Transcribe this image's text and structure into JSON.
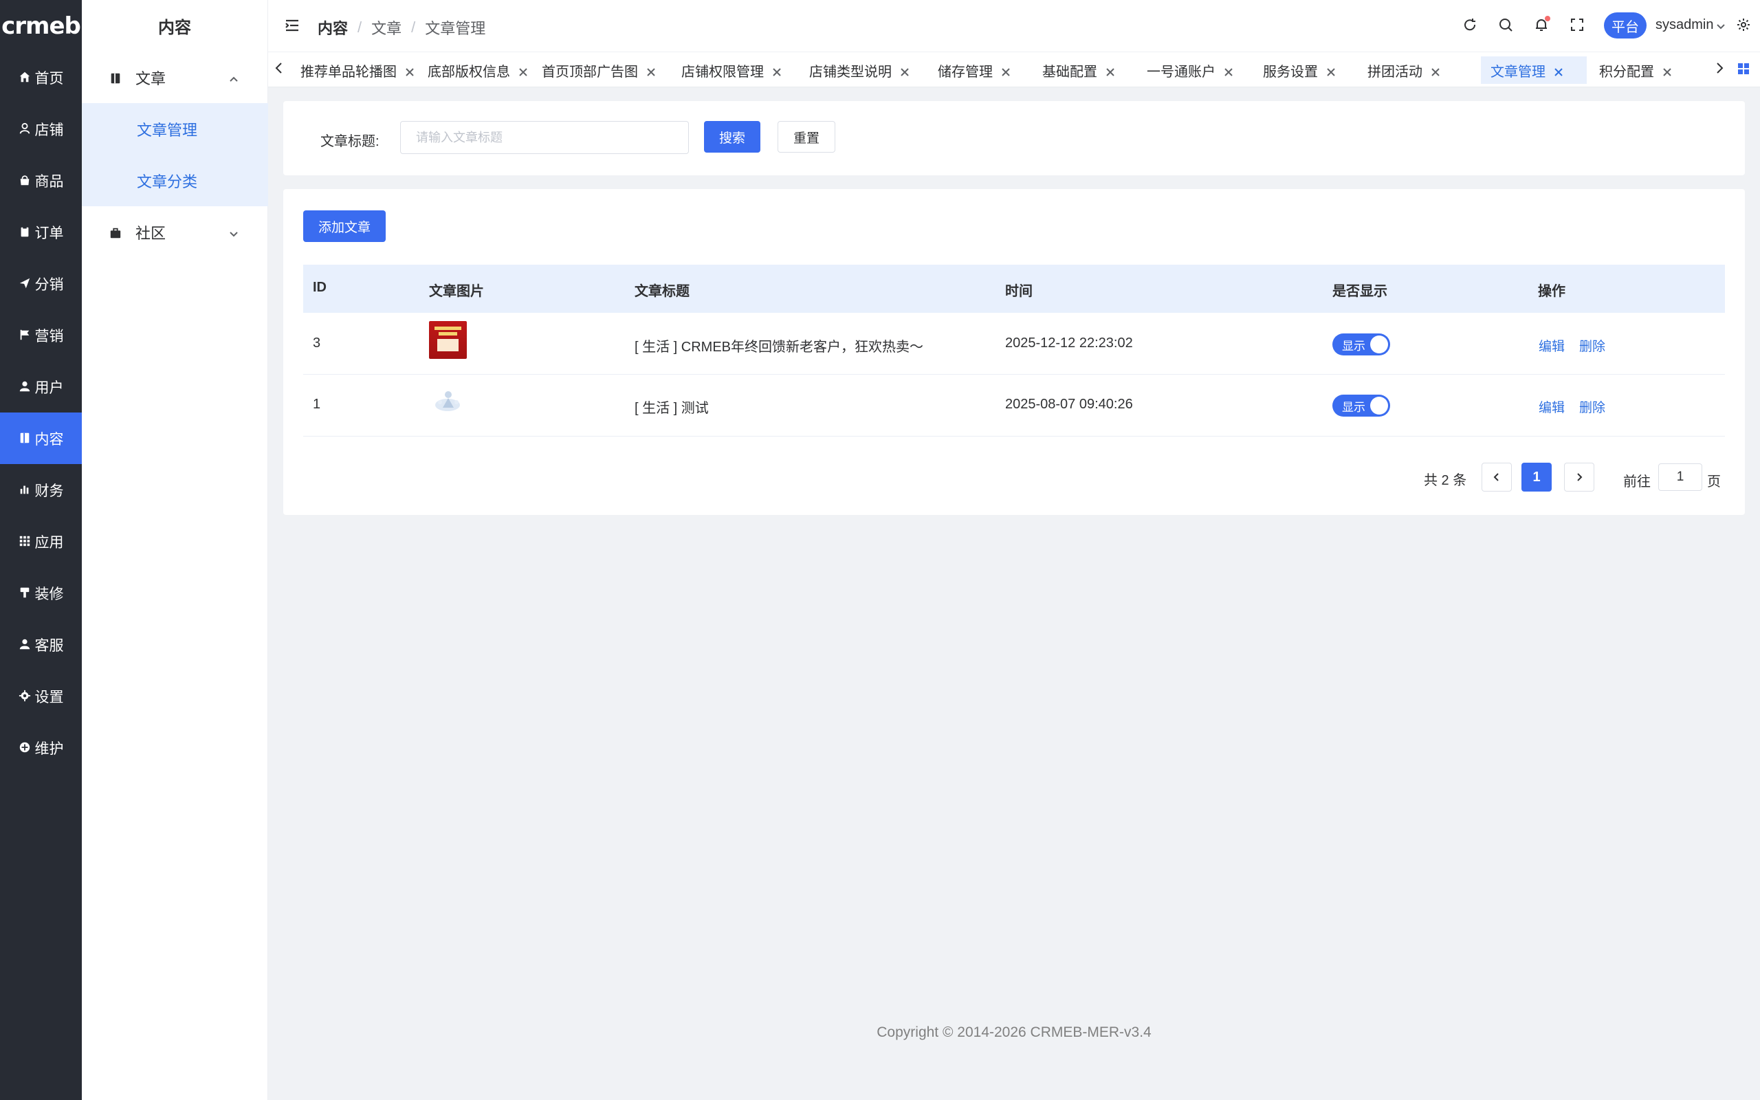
{
  "logo_text": "crmeb",
  "main_menu": [
    {
      "label": "首页",
      "icon": "home-icon"
    },
    {
      "label": "店铺",
      "icon": "shop-icon"
    },
    {
      "label": "商品",
      "icon": "bag-icon"
    },
    {
      "label": "订单",
      "icon": "clipboard-icon"
    },
    {
      "label": "分销",
      "icon": "send-icon"
    },
    {
      "label": "营销",
      "icon": "flag-icon"
    },
    {
      "label": "用户",
      "icon": "user-icon"
    },
    {
      "label": "内容",
      "icon": "book-icon"
    },
    {
      "label": "财务",
      "icon": "chart-icon"
    },
    {
      "label": "应用",
      "icon": "grid-icon"
    },
    {
      "label": "装修",
      "icon": "brush-icon"
    },
    {
      "label": "客服",
      "icon": "headset-icon"
    },
    {
      "label": "设置",
      "icon": "gear-icon"
    },
    {
      "label": "维护",
      "icon": "wrench-icon"
    }
  ],
  "active_menu": "内容",
  "accent_color": "#3a6cf0",
  "sub_sidebar": {
    "title": "内容",
    "group_article": "文章",
    "item_manage": "文章管理",
    "item_category": "文章分类",
    "group_community": "社区"
  },
  "header": {
    "breadcrumb": [
      "内容",
      "文章",
      "文章管理"
    ],
    "platform_label": "平台",
    "user_name": "sysadmin"
  },
  "tabs": [
    {
      "label": "推荐单品轮播图"
    },
    {
      "label": "底部版权信息"
    },
    {
      "label": "首页顶部广告图"
    },
    {
      "label": "店铺权限管理"
    },
    {
      "label": "店铺类型说明"
    },
    {
      "label": "储存管理"
    },
    {
      "label": "基础配置"
    },
    {
      "label": "一号通账户"
    },
    {
      "label": "服务设置"
    },
    {
      "label": "拼团活动"
    },
    {
      "label": "文章管理"
    },
    {
      "label": "积分配置"
    }
  ],
  "active_tab": "文章管理",
  "search": {
    "label": "文章标题:",
    "placeholder": "请输入文章标题",
    "search_btn": "搜索",
    "reset_btn": "重置"
  },
  "table": {
    "add_btn": "添加文章",
    "columns": [
      "ID",
      "文章图片",
      "文章标题",
      "时间",
      "是否显示",
      "操作"
    ],
    "rows": [
      {
        "id": "3",
        "title": "[ 生活 ] CRMEB年终回馈新老客户，狂欢热卖～",
        "time": "2025-12-12 22:23:02",
        "show": "显示",
        "edit": "编辑",
        "delete": "删除"
      },
      {
        "id": "1",
        "title": "[ 生活 ] 测试",
        "time": "2025-08-07 09:40:26",
        "show": "显示",
        "edit": "编辑",
        "delete": "删除"
      }
    ]
  },
  "pagination": {
    "total": "共 2 条",
    "current_page": "1",
    "goto_label": "前往",
    "goto_value": "1",
    "page_label": "页"
  },
  "footer": "Copyright © 2014-2026 CRMEB-MER-v3.4"
}
